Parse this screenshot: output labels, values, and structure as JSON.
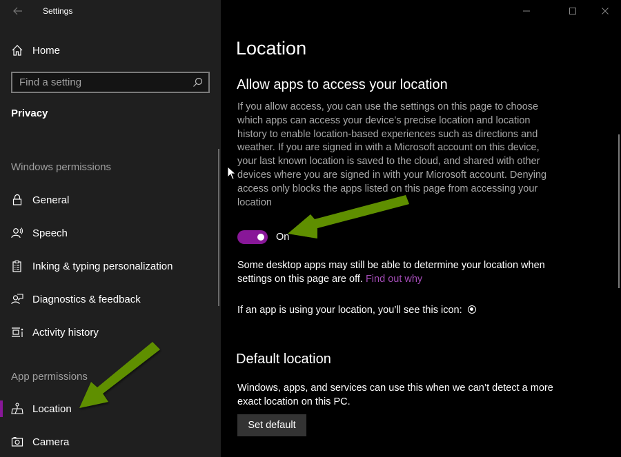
{
  "window": {
    "title": "Settings",
    "minimize_icon": "minimize-icon",
    "maximize_icon": "maximize-icon",
    "close_icon": "close-icon"
  },
  "sidebar": {
    "home_label": "Home",
    "search": {
      "placeholder": "Find a setting",
      "value": ""
    },
    "section": "Privacy",
    "windows_permissions_label": "Windows permissions",
    "windows_permissions": [
      {
        "label": "General",
        "icon": "lock-icon"
      },
      {
        "label": "Speech",
        "icon": "speech-icon"
      },
      {
        "label": "Inking & typing personalization",
        "icon": "clipboard-icon"
      },
      {
        "label": "Diagnostics & feedback",
        "icon": "feedback-icon"
      },
      {
        "label": "Activity history",
        "icon": "timeline-icon"
      }
    ],
    "app_permissions_label": "App permissions",
    "app_permissions": [
      {
        "label": "Location",
        "icon": "location-icon",
        "selected": true
      },
      {
        "label": "Camera",
        "icon": "camera-icon",
        "selected": false
      }
    ]
  },
  "main": {
    "title": "Location",
    "allow_section": {
      "heading": "Allow apps to access your location",
      "description": "If you allow access, you can use the settings on this page to choose which apps can access your device’s precise location and location history to enable location-based experiences such as directions and weather. If you are signed in with a Microsoft account on this device, your last known location is saved to the cloud, and shared with other devices where you are signed in with your Microsoft account. Denying access only blocks the apps listed on this page from accessing your location",
      "toggle_state": "On",
      "toggle_on": true,
      "desktop_note": "Some desktop apps may still be able to determine your location when settings on this page are off.",
      "find_out_link": "Find out why",
      "icon_note": "If an app is using your location, you’ll see this icon:"
    },
    "default_section": {
      "heading": "Default location",
      "description": "Windows, apps, and services can use this when we can’t detect a more exact location on this PC.",
      "button_label": "Set default"
    }
  },
  "colors": {
    "accent": "#881798",
    "link": "#a54cb8",
    "annotation_arrow": "#5f8f00"
  }
}
